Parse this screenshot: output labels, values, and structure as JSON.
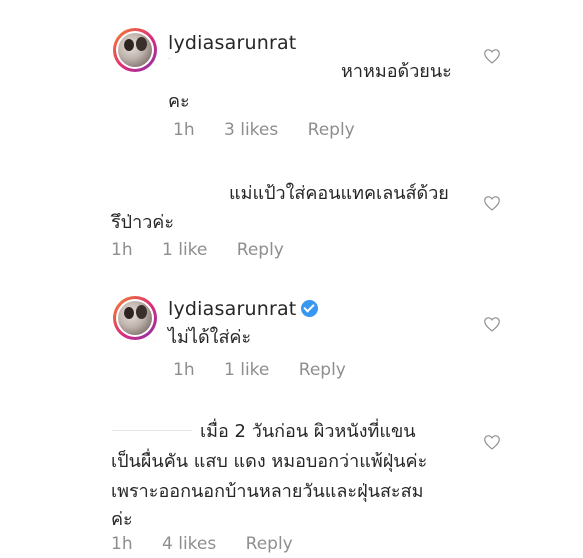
{
  "comments": [
    {
      "username": "lydiasarunrat",
      "lines": [
        "หาหมอด้วยนะ",
        "คะ"
      ],
      "time": "1h",
      "likes": "3 likes",
      "reply": "Reply"
    },
    {
      "lines": [
        "แม่แป้วใส่คอนแทคเลนส์ด้วย",
        "รึป่าวค่ะ"
      ],
      "time": "1h",
      "likes": "1 like",
      "reply": "Reply"
    },
    {
      "username": "lydiasarunrat",
      "lines": [
        "ไม่ได้ใส่ค่ะ"
      ],
      "time": "1h",
      "likes": "1 like",
      "reply": "Reply"
    },
    {
      "lines": [
        "เมื่อ 2 วันก่อน ผิวหนังที่แขน",
        "เป็นผื่นคัน แสบ แดง  หมอบอกว่าแพ้ฝุ่นค่ะ",
        "เพราะออกนอกบ้านหลายวันและฝุ่นสะสม",
        "ค่ะ"
      ],
      "time": "1h",
      "likes": "4 likes",
      "reply": "Reply"
    }
  ],
  "icons": {
    "like": "heart-outline-icon",
    "verified": "verified-badge-icon"
  },
  "colors": {
    "text": "#262626",
    "meta": "#8e8e8e",
    "verified": "#3897f0"
  }
}
